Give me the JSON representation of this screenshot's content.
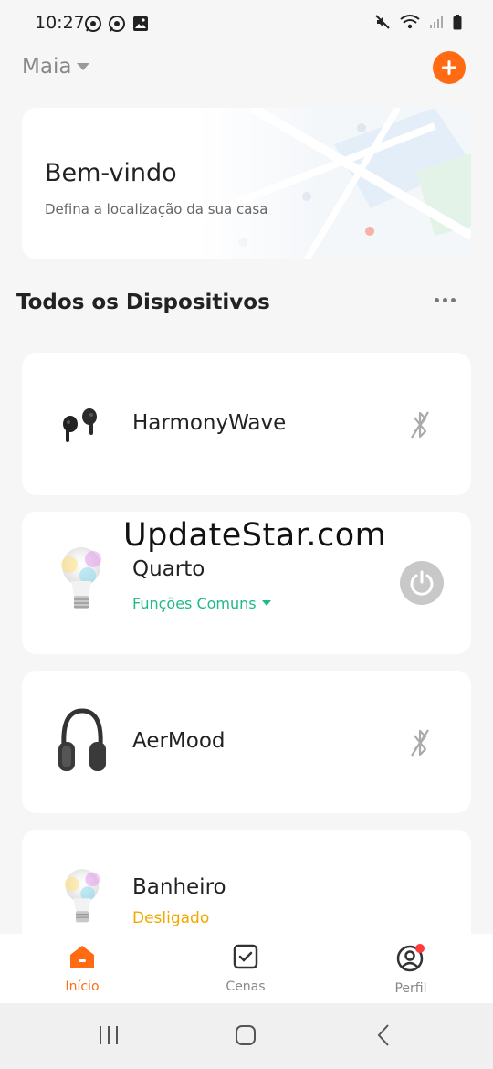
{
  "status_bar": {
    "time": "10:27"
  },
  "header": {
    "home_name": "Maia"
  },
  "welcome": {
    "title": "Bem-vindo",
    "subtitle": "Defina a localização da sua casa"
  },
  "section": {
    "title": "Todos os Dispositivos"
  },
  "devices": [
    {
      "name": "HarmonyWave",
      "icon": "earbuds"
    },
    {
      "name": "Quarto",
      "subtitle": "Funções Comuns",
      "icon": "light-bulb"
    },
    {
      "name": "AerMood",
      "icon": "headphones"
    },
    {
      "name": "Banheiro",
      "subtitle": "Desligado",
      "icon": "light-bulb"
    }
  ],
  "watermark": "UpdateStar.com",
  "tabs": [
    {
      "label": "Início",
      "active": true
    },
    {
      "label": "Cenas"
    },
    {
      "label": "Perfil"
    }
  ],
  "colors": {
    "accent": "#ff6a13",
    "functions": "#1fb98a",
    "off_status": "#f0a800",
    "badge": "#ff3b3b"
  }
}
